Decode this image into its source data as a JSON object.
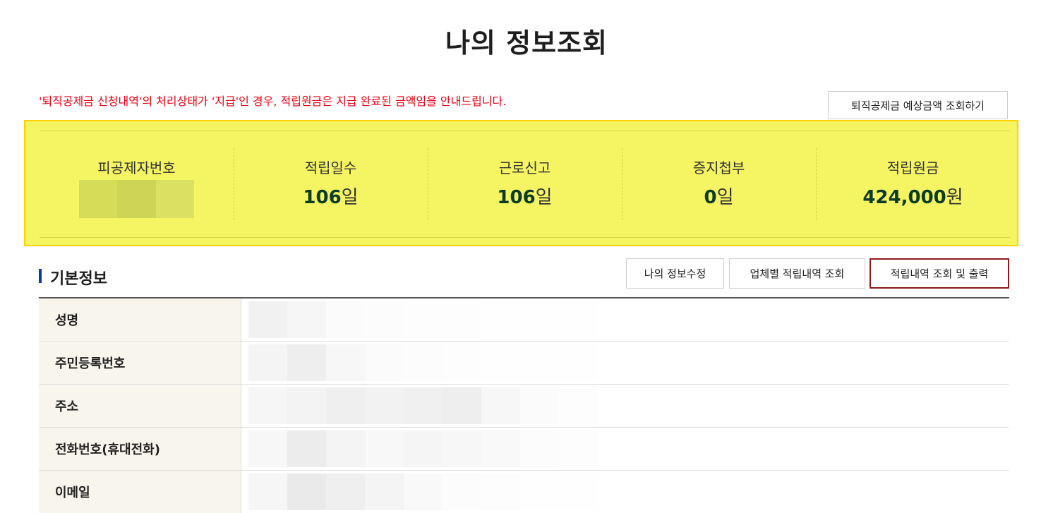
{
  "page": {
    "title": "나의 정보조회"
  },
  "notice": {
    "text": "'퇴직공제금 신청내역'의 처리상태가 '지급'인 경우, 적립원금은 지급 완료된 금액임을 안내드립니다.",
    "color": "#e60012"
  },
  "estimate_button": {
    "label": "퇴직공제금 예상금액 조회하기"
  },
  "summary": {
    "background": "#f5f462",
    "items": [
      {
        "label": "피공제자번호",
        "value": "",
        "unit": ""
      },
      {
        "label": "적립일수",
        "value": "106",
        "unit": "일"
      },
      {
        "label": "근로신고",
        "value": "106",
        "unit": "일"
      },
      {
        "label": "증지첩부",
        "value": "0",
        "unit": "일"
      },
      {
        "label": "적립원금",
        "value": "424,000",
        "unit": "원"
      }
    ]
  },
  "basic_info": {
    "title": "기본정보",
    "buttons": {
      "edit": "나의 정보수정",
      "by_company": "업체별 적립내역 조회",
      "print": "적립내역 조회 및 출력"
    },
    "rows": [
      {
        "label": "성명"
      },
      {
        "label": "주민등록번호"
      },
      {
        "label": "주소"
      },
      {
        "label": "전화번호(휴대전화)"
      },
      {
        "label": "이메일"
      }
    ]
  }
}
